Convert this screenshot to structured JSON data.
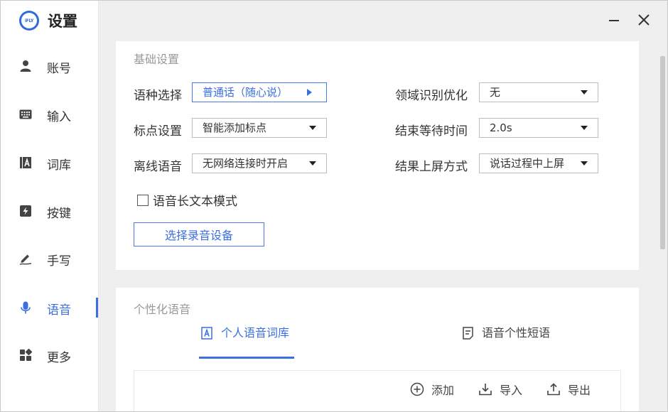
{
  "app": {
    "title": "设置",
    "logo_text": "iFLY"
  },
  "sidebar": {
    "items": [
      {
        "label": "账号",
        "icon": "user-icon"
      },
      {
        "label": "输入",
        "icon": "keyboard-icon"
      },
      {
        "label": "词库",
        "icon": "dictionary-icon"
      },
      {
        "label": "按键",
        "icon": "lightning-key-icon"
      },
      {
        "label": "手写",
        "icon": "pen-icon"
      },
      {
        "label": "语音",
        "icon": "microphone-icon",
        "active": true
      },
      {
        "label": "更多",
        "icon": "apps-grid-icon"
      }
    ]
  },
  "basic": {
    "title": "基础设置",
    "language": {
      "label": "语种选择",
      "value": "普通话（随心说）"
    },
    "punctuation": {
      "label": "标点设置",
      "value": "智能添加标点"
    },
    "offline": {
      "label": "离线语音",
      "value": "无网络连接时开启"
    },
    "domain": {
      "label": "领域识别优化",
      "value": "无"
    },
    "wait_time": {
      "label": "结束等待时间",
      "value": "2.0s"
    },
    "output_mode": {
      "label": "结果上屏方式",
      "value": "说话过程中上屏"
    },
    "long_text": {
      "label": "语音长文本模式",
      "checked": false
    },
    "select_device_button": "选择录音设备"
  },
  "personal": {
    "title": "个性化语音",
    "tabs": [
      {
        "label": "个人语音词库",
        "icon": "dictionary-icon",
        "active": true
      },
      {
        "label": "语音个性短语",
        "icon": "note-icon",
        "active": false
      }
    ],
    "toolbar": {
      "add": "添加",
      "import": "导入",
      "export": "导出"
    }
  },
  "colors": {
    "accent": "#3b6fe0",
    "panel_bg": "#ffffff",
    "window_bg": "#efefef"
  }
}
